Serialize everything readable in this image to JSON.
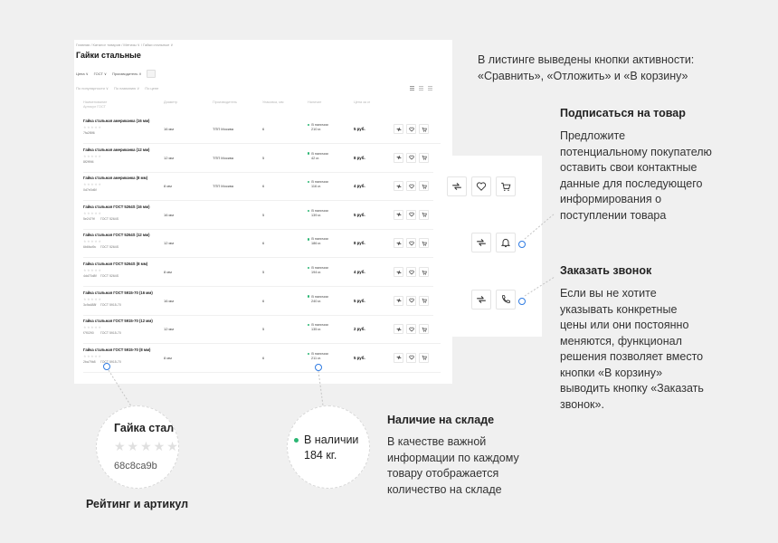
{
  "listing": {
    "breadcrumbs": "Главная  /  Каталог товаров  /  Метизы  ∨  /  Гайки стальные  ∨",
    "title": "Гайки стальные",
    "filters": [
      "Цена ∨",
      "ГОСТ ∨",
      "Производитель ∨"
    ],
    "sorts": [
      "По популярности ∨",
      "По названию ∨",
      "По цене"
    ],
    "columns": {
      "name": "Наименование",
      "sub": "Артикул  ГОСТ",
      "diameter": "Диаметр",
      "maker": "Производитель",
      "pack": "Упаковка, мм",
      "stock": "Наличие",
      "price": "Цена за кг"
    },
    "rows": [
      {
        "name": "Гайка стальная американка (16 мм)",
        "sku": "7fa2f8f6",
        "gost": "",
        "diameter": "16 мм",
        "maker": "ТПП Москва",
        "pack": "6",
        "stock_label": "В наличии",
        "stock_qty": "210 кг.",
        "price": "5 руб."
      },
      {
        "name": "Гайка стальная американка (12 мм)",
        "sku": "8f2ff9f4",
        "gost": "",
        "diameter": "12 мм",
        "maker": "ТПП Москва",
        "pack": "5",
        "stock_label": "В наличии",
        "stock_qty": "42 кг.",
        "price": "8 руб."
      },
      {
        "name": "Гайка стальная американка (8 мм)",
        "sku": "0d7e0d6f",
        "gost": "",
        "diameter": "8 мм",
        "maker": "ТПП Москва",
        "pack": "6",
        "stock_label": "В наличии",
        "stock_qty": "116 кг.",
        "price": "4 руб."
      },
      {
        "name": "Гайка стальная ГОСТ 5264S (16 мм)",
        "sku": "5e2479f",
        "gost": "ГОСТ 5264S",
        "diameter": "16 мм",
        "maker": "",
        "pack": "5",
        "stock_label": "В наличии",
        "stock_qty": "139 кг.",
        "price": "5 руб."
      },
      {
        "name": "Гайка стальная ГОСТ 5264S (12 мм)",
        "sku": "6b6fcd9c",
        "gost": "ГОСТ 5264S",
        "diameter": "12 мм",
        "maker": "",
        "pack": "6",
        "stock_label": "В наличии",
        "stock_qty": "186 кг.",
        "price": "8 руб."
      },
      {
        "name": "Гайка стальная ГОСТ 5264S (8 мм)",
        "sku": "4dd70d8f",
        "gost": "ГОСТ 5264S",
        "diameter": "8 мм",
        "maker": "",
        "pack": "5",
        "stock_label": "В наличии",
        "stock_qty": "194 кг.",
        "price": "4 руб."
      },
      {
        "name": "Гайка стальная ГОСТ 5915-70 (16 мм)",
        "sku": "3c9a488f",
        "gost": "ГОСТ 5915-70",
        "diameter": "16 мм",
        "maker": "",
        "pack": "6",
        "stock_label": "В наличии",
        "stock_qty": "240 кг.",
        "price": "5 руб."
      },
      {
        "name": "Гайка стальная ГОСТ 5915-70 (12 мм)",
        "sku": "f7f0290",
        "gost": "ГОСТ 5915-70",
        "diameter": "12 мм",
        "maker": "",
        "pack": "5",
        "stock_label": "В наличии",
        "stock_qty": "135 кг.",
        "price": "2 руб."
      },
      {
        "name": "Гайка стальная ГОСТ 5915-70 (8 мм)",
        "sku": "2ba79b8",
        "gost": "ГОСТ 5915-70",
        "diameter": "8 мм",
        "maker": "",
        "pack": "6",
        "stock_label": "В наличии",
        "stock_qty": "211 кг.",
        "price": "5 руб."
      }
    ]
  },
  "notes": {
    "intro": "В листинге выведены кнопки активности: «Сравнить», «Отложить» и «В корзину»",
    "subscribe_title": "Подписаться на товар",
    "subscribe_text": "Предложите потенциальному покупателю оставить свои контактные данные для последующего информирования о поступлении товара",
    "call_title": "Заказать звонок",
    "call_text": "Если вы не хотите указывать конкретные цены или они постоянно меняются, функционал решения позволяет вместо кнопки «В корзину» выводить кнопку «Заказать звонок».",
    "stock_title": "Наличие на складе",
    "stock_text": "В качестве важной информации по каждому товару отображается количество на складе",
    "rating_title": "Рейтинг и артикул"
  },
  "zoom_rating": {
    "name": "Гайка стал",
    "stars": "★★★★★",
    "sku": "68c8ca9b"
  },
  "zoom_stock": {
    "label": "В наличии",
    "qty": "184 кг."
  },
  "colors": {
    "accent": "#2f7be2",
    "in_stock": "#2bb673"
  }
}
